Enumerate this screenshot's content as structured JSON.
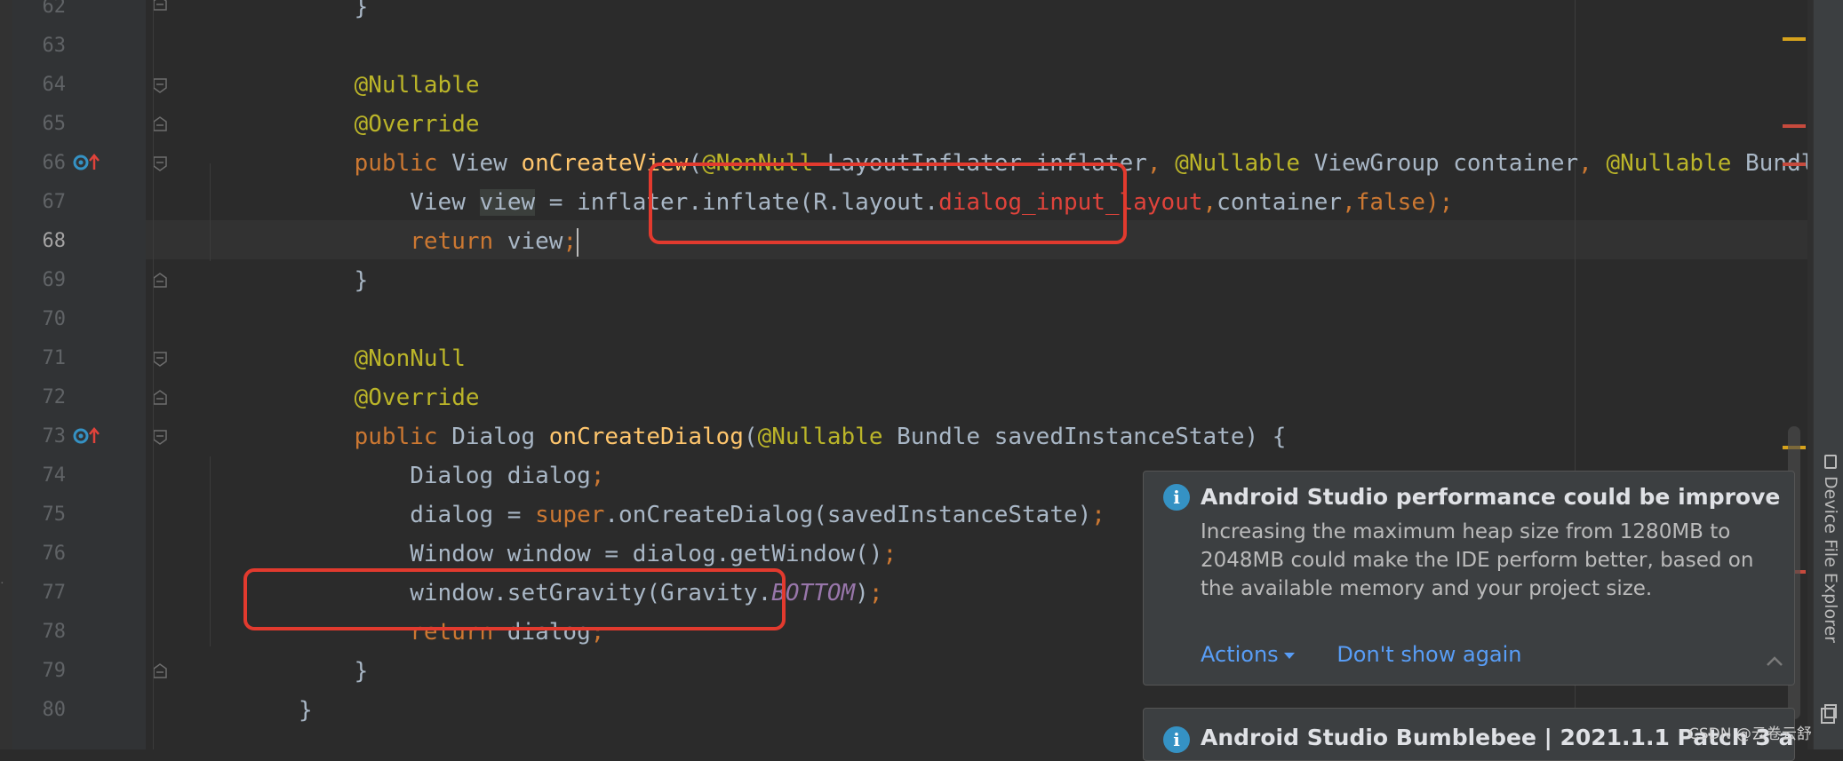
{
  "editor": {
    "language": "java",
    "current_line": "68",
    "lines": [
      {
        "num": "62",
        "text": "    }"
      },
      {
        "num": "63",
        "text": ""
      },
      {
        "num": "64",
        "text": "    @Nullable"
      },
      {
        "num": "65",
        "text": "    @Override"
      },
      {
        "num": "66",
        "text": "    public View onCreateView(@NonNull LayoutInflater inflater, @Nullable ViewGroup container, @Nullable Bundle savedI"
      },
      {
        "num": "67",
        "text": "        View view = inflater.inflate(R.layout.dialog_input_layout,container,false);"
      },
      {
        "num": "68",
        "text": "        return view;"
      },
      {
        "num": "69",
        "text": "    }"
      },
      {
        "num": "70",
        "text": ""
      },
      {
        "num": "71",
        "text": "    @NonNull"
      },
      {
        "num": "72",
        "text": "    @Override"
      },
      {
        "num": "73",
        "text": "    public Dialog onCreateDialog(@Nullable Bundle savedInstanceState) {"
      },
      {
        "num": "74",
        "text": "        Dialog dialog;"
      },
      {
        "num": "75",
        "text": "        dialog = super.onCreateDialog(savedInstanceState);"
      },
      {
        "num": "76",
        "text": "        Window window = dialog.getWindow();"
      },
      {
        "num": "77",
        "text": "        window.setGravity(Gravity.BOTTOM);"
      },
      {
        "num": "78",
        "text": "        return dialog;"
      },
      {
        "num": "79",
        "text": "    }"
      },
      {
        "num": "80",
        "text": "}"
      }
    ],
    "tokens": {
      "l62": [
        "}"
      ],
      "l64": [
        "@Nullable"
      ],
      "l65": [
        "@Override"
      ],
      "l66": [
        "public",
        " View ",
        "onCreateView",
        "(",
        "@NonNull",
        " LayoutInflater inflater",
        ", ",
        "@Nullable",
        " ViewGroup container",
        ", ",
        "@Nullable",
        " Bundle savedI"
      ],
      "l67": [
        "View ",
        "view",
        " = inflater.inflate(R.layout.",
        "dialog_input_layout",
        ",",
        "container",
        ",",
        "false",
        ");"
      ],
      "l68": [
        "return",
        " view",
        ";"
      ],
      "l69": [
        "}"
      ],
      "l71": [
        "@NonNull"
      ],
      "l72": [
        "@Override"
      ],
      "l73": [
        "public",
        " Dialog ",
        "onCreateDialog",
        "(",
        "@Nullable",
        " Bundle savedInstanceState) {"
      ],
      "l74": [
        "Dialog dialog",
        ";"
      ],
      "l75": [
        "dialog = ",
        "super",
        ".onCreateDialog(savedInstanceState)",
        ";"
      ],
      "l76": [
        "Window window = dialog.getWindow()",
        ";"
      ],
      "l77": [
        "window.setGravity(Gravity.",
        "BOTTOM",
        ")",
        ";"
      ],
      "l78": [
        "return",
        " dialog",
        ";"
      ],
      "l79": [
        "}"
      ],
      "l80": [
        "}"
      ]
    }
  },
  "colors": {
    "background": "#2b2b2b",
    "annotation": "#bbb529",
    "keyword": "#cc7832",
    "method_decl": "#ffc66d",
    "resource_ref": "#e0433b",
    "constant": "#9876aa",
    "highlight_box": "#e23a2e",
    "link": "#589df6"
  },
  "right_toolbar": {
    "device_file_explorer": "Device File Explorer"
  },
  "notifications": [
    {
      "icon": "info-icon",
      "title": "Android Studio performance could be improve",
      "body": "Increasing the maximum heap size from 1280MB to 2048MB could make the IDE perform better, based on the available memory and your project size.",
      "actions_label": "Actions",
      "dismiss_label": "Don't show again"
    },
    {
      "icon": "info-icon",
      "title": "Android Studio Bumblebee | 2021.1.1 Patch 3 a"
    }
  ],
  "watermark": "CSDN @云卷云舒"
}
